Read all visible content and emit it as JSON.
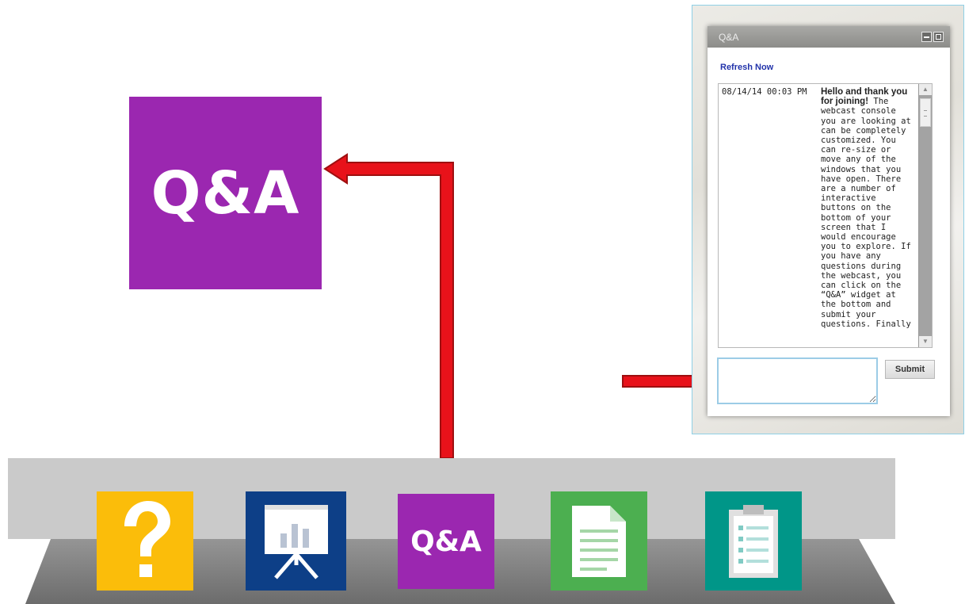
{
  "big_tile": {
    "label": "Q&A",
    "color": "#9b27b0",
    "icon": "qa-tile"
  },
  "panel": {
    "title": "Q&A",
    "refresh_label": "Refresh Now",
    "messages": [
      {
        "time": "08/14/14 00:03 PM",
        "heading": "Hello and thank you for joining!",
        "body": "The webcast console you are looking at can be completely customized. You can re-size or move any of the windows that you have open. There are a number of interactive buttons on the bottom of your screen that I would encourage you to explore. If you have any questions during the webcast, you can click on the “Q&A” widget at the bottom and submit your questions. Finally"
      }
    ],
    "input_value": "",
    "submit_label": "Submit"
  },
  "toolbar": {
    "items": [
      {
        "name": "help",
        "icon": "question-mark-icon",
        "color": "#fbbd0a"
      },
      {
        "name": "presentation",
        "icon": "presentation-board-icon",
        "color": "#0d3f87"
      },
      {
        "name": "qa",
        "label": "Q&A",
        "icon": "qa-tile",
        "color": "#9b27b0"
      },
      {
        "name": "document",
        "icon": "document-icon",
        "color": "#4caf50"
      },
      {
        "name": "clipboard",
        "icon": "clipboard-icon",
        "color": "#009688"
      }
    ]
  },
  "annotation_color": "#e8121a"
}
